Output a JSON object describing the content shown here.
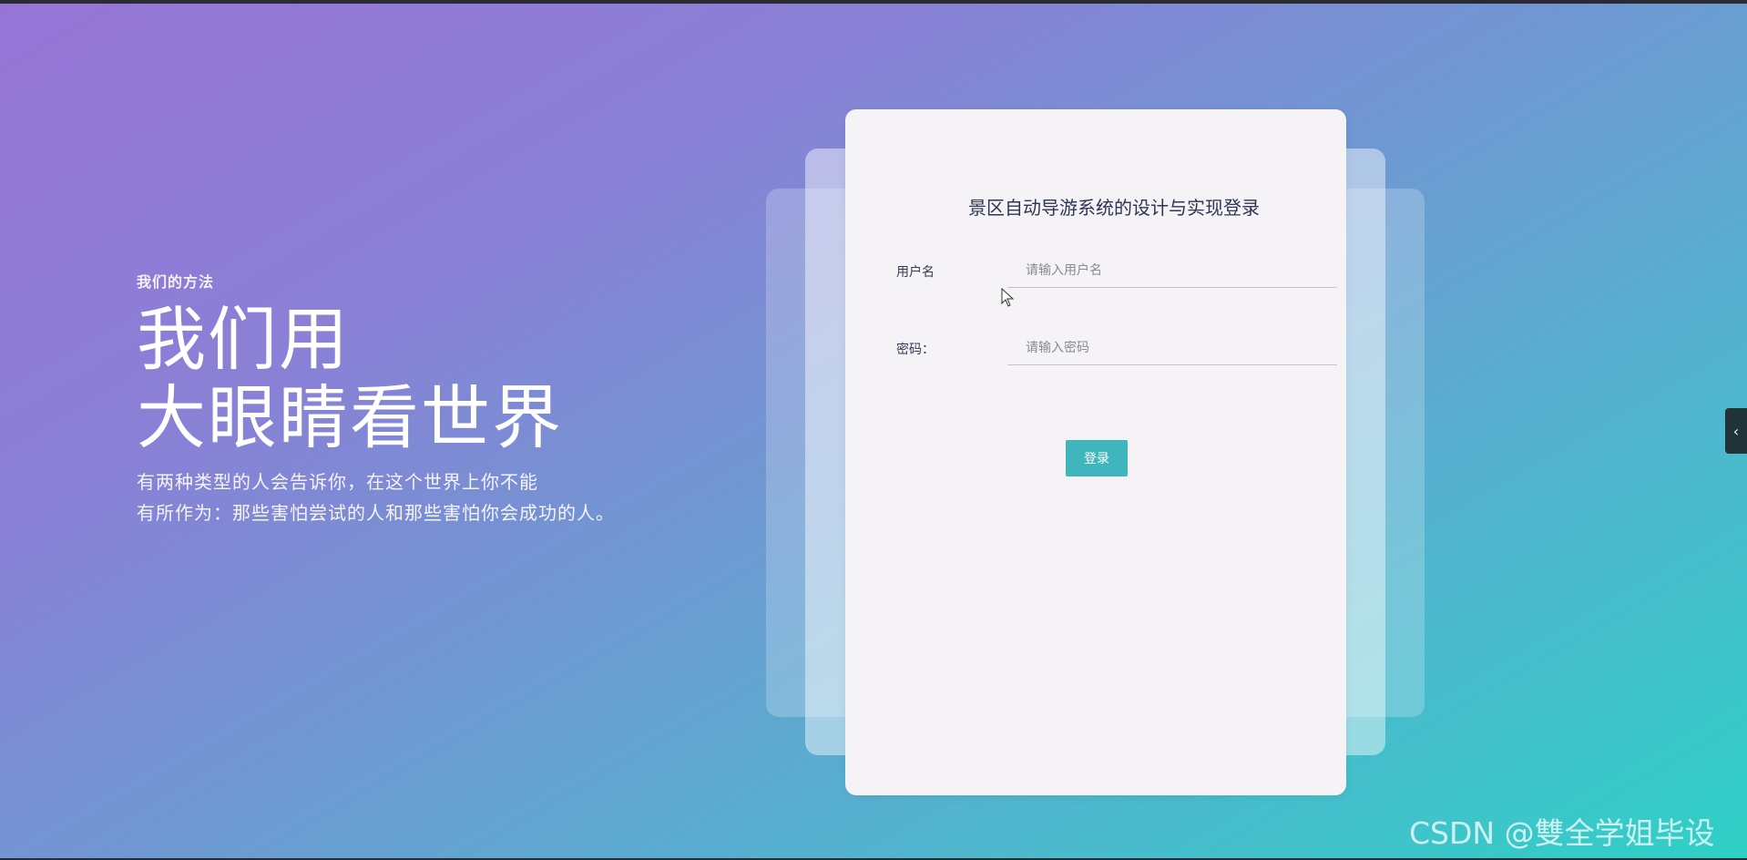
{
  "hero": {
    "eyebrow": "我们的方法",
    "title_line1": "我们用",
    "title_line2": "大眼睛看世界",
    "desc_line1": "有两种类型的人会告诉你，在这个世界上你不能",
    "desc_line2": "有所作为：那些害怕尝试的人和那些害怕你会成功的人。"
  },
  "login": {
    "title": "景区自动导游系统的设计与实现登录",
    "username_label": "用户名",
    "username_placeholder": "请输入用户名",
    "username_value": "",
    "password_label": "密码：",
    "password_placeholder": "请输入密码",
    "password_value": "",
    "submit_label": "登录"
  },
  "side_toggle": {
    "icon": "chevron-left-icon",
    "glyph": "‹"
  },
  "watermark": "CSDN @雙全学姐毕设",
  "colors": {
    "gradient_start": "#9775d6",
    "gradient_end": "#2fd0c6",
    "button": "#3fb6bd",
    "card": "#f5f3f6"
  }
}
